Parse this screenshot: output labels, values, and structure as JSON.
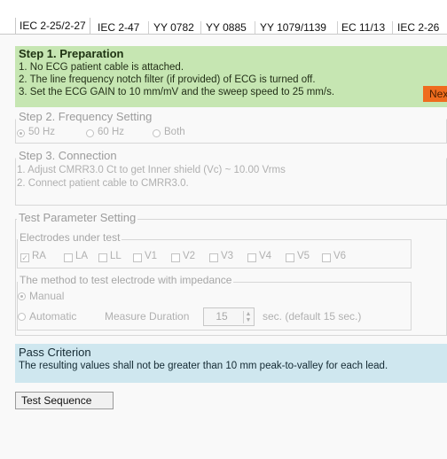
{
  "tabs": [
    {
      "label": "IEC 2-25/2-27"
    },
    {
      "label": "IEC 2-47"
    },
    {
      "label": "YY 0782"
    },
    {
      "label": "YY 0885"
    },
    {
      "label": "YY 1079/1139"
    },
    {
      "label": "EC 11/13"
    },
    {
      "label": "IEC 2-26"
    }
  ],
  "step1": {
    "title": "Step 1. Preparation",
    "lines": [
      "1. No ECG patient cable is attached.",
      "2. The line frequency notch filter (if provided) of ECG is turned off.",
      "3. Set the ECG GAIN to 10 mm/mV and the sweep speed to 25 mm/s."
    ],
    "next_label": "Next",
    "accent": "#ef6c1e",
    "background": "#c6e6b2"
  },
  "step2": {
    "title": "Step 2. Frequency Setting",
    "options": [
      {
        "label": "50 Hz",
        "selected": true
      },
      {
        "label": "60 Hz",
        "selected": false
      },
      {
        "label": "Both",
        "selected": false
      }
    ]
  },
  "step3": {
    "title": "Step 3. Connection",
    "lines": [
      "1. Adjust CMRR3.0 Ct to get Inner shield (Vc) ~ 10.00 Vrms",
      "2. Connect patient cable to CMRR3.0."
    ]
  },
  "params": {
    "title": "Test Parameter Setting",
    "electrodes_title": "Electrodes under test",
    "electrodes": [
      {
        "label": "RA",
        "checked": true
      },
      {
        "label": "LA",
        "checked": false
      },
      {
        "label": "LL",
        "checked": false
      },
      {
        "label": "V1",
        "checked": false
      },
      {
        "label": "V2",
        "checked": false
      },
      {
        "label": "V3",
        "checked": false
      },
      {
        "label": "V4",
        "checked": false
      },
      {
        "label": "V5",
        "checked": false
      },
      {
        "label": "V6",
        "checked": false
      }
    ],
    "method_title": "The method to test electrode with impedance",
    "manual_label": "Manual",
    "automatic_label": "Automatic",
    "measure_label": "Measure Duration",
    "duration_value": "15",
    "duration_suffix": "sec. (default 15 sec.)"
  },
  "pass": {
    "title": "Pass Criterion",
    "text": "The resulting values shall not be greater than 10 mm peak-to-valley for each lead.",
    "background": "#cfe7ef"
  },
  "test_sequence_label": "Test Sequence"
}
